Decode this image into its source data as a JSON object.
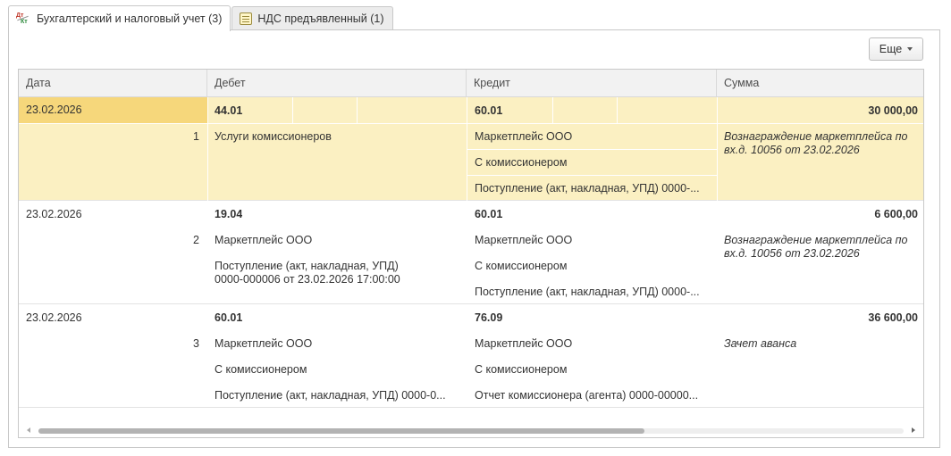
{
  "tabs": [
    {
      "label": "Бухгалтерский и налоговый учет (3)",
      "icon": "dt-kt-icon",
      "active": true
    },
    {
      "label": "НДС предъявленный (1)",
      "icon": "document-icon",
      "active": false
    }
  ],
  "toolbar": {
    "more_label": "Еще"
  },
  "columns": {
    "date": "Дата",
    "debit": "Дебет",
    "credit": "Кредит",
    "sum": "Сумма"
  },
  "rows": [
    {
      "date": "23.02.2026",
      "num": "1",
      "debit_account": "44.01",
      "debit_lines": [
        "Услуги комиссионеров"
      ],
      "credit_account": "60.01",
      "credit_lines": [
        "Маркетплейс ООО",
        "С комиссионером",
        "Поступление (акт, накладная, УПД) 0000-..."
      ],
      "amount": "30 000,00",
      "comment": "Вознаграждение маркетплейса по вх.д. 10056 от 23.02.2026",
      "selected": true
    },
    {
      "date": "23.02.2026",
      "num": "2",
      "debit_account": "19.04",
      "debit_lines": [
        "Маркетплейс ООО",
        "Поступление (акт, накладная, УПД)",
        "0000-000006 от 23.02.2026 17:00:00"
      ],
      "credit_account": "60.01",
      "credit_lines": [
        "Маркетплейс ООО",
        "С комиссионером",
        "Поступление (акт, накладная, УПД) 0000-..."
      ],
      "amount": "6 600,00",
      "comment": "Вознаграждение маркетплейса по вх.д. 10056 от 23.02.2026",
      "selected": false
    },
    {
      "date": "23.02.2026",
      "num": "3",
      "debit_account": "60.01",
      "debit_lines": [
        "Маркетплейс ООО",
        "С комиссионером",
        "Поступление (акт, накладная, УПД) 0000-0..."
      ],
      "credit_account": "76.09",
      "credit_lines": [
        "Маркетплейс ООО",
        "С комиссионером",
        "Отчет комиссионера (агента) 0000-00000..."
      ],
      "amount": "36 600,00",
      "comment": "Зачет аванса",
      "selected": false
    }
  ],
  "colors": {
    "selected_row": "#fbf0c2",
    "selected_cell": "#f6d77b",
    "header_bg": "#f2f2f2"
  }
}
